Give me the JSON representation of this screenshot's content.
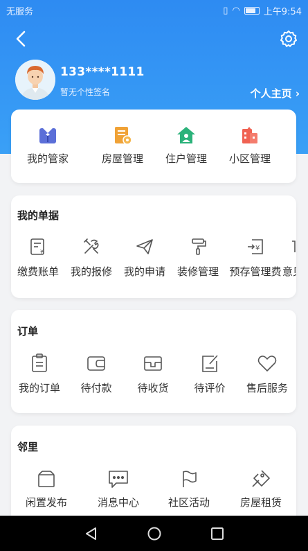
{
  "status_bar": {
    "carrier": "无服务",
    "time": "上午9:54"
  },
  "header": {
    "back_icon": "chevron-left-icon",
    "settings_icon": "gear-icon",
    "phone": "133****1111",
    "signature": "暂无个性签名",
    "homepage_label": "个人主页",
    "homepage_arrow": "›"
  },
  "quick_menu": [
    {
      "label": "我的管家",
      "icon": "butler-icon",
      "color": "#5b6fd8"
    },
    {
      "label": "房屋管理",
      "icon": "house-doc-icon",
      "color": "#f0a236"
    },
    {
      "label": "住户管理",
      "icon": "home-user-icon",
      "color": "#2bb27a"
    },
    {
      "label": "小区管理",
      "icon": "community-icon",
      "color": "#f06252"
    }
  ],
  "bills": {
    "title": "我的单据",
    "items": [
      {
        "label": "缴费账单",
        "icon": "bill-icon"
      },
      {
        "label": "我的报修",
        "icon": "repair-tools-icon"
      },
      {
        "label": "我的申请",
        "icon": "paper-plane-icon"
      },
      {
        "label": "装修管理",
        "icon": "paint-roller-icon"
      },
      {
        "label": "预存管理费",
        "icon": "prepay-icon"
      },
      {
        "label": "意见",
        "icon": "more-icon"
      }
    ]
  },
  "orders": {
    "title": "订单",
    "items": [
      {
        "label": "我的订单",
        "icon": "clipboard-icon"
      },
      {
        "label": "待付款",
        "icon": "wallet-icon"
      },
      {
        "label": "待收货",
        "icon": "package-icon"
      },
      {
        "label": "待评价",
        "icon": "review-edit-icon"
      },
      {
        "label": "售后服务",
        "icon": "heart-icon"
      }
    ]
  },
  "neighbor": {
    "title": "邻里",
    "items": [
      {
        "label": "闲置发布",
        "icon": "box-icon"
      },
      {
        "label": "消息中心",
        "icon": "chat-bubble-icon"
      },
      {
        "label": "社区活动",
        "icon": "flag-icon"
      },
      {
        "label": "房屋租赁",
        "icon": "key-tag-icon"
      }
    ]
  },
  "nav_bar": {
    "back": "triangle-back-icon",
    "home": "circle-home-icon",
    "recent": "square-recent-icon"
  },
  "colors": {
    "primary": "#2e8bf2",
    "icon_stroke": "#555555"
  }
}
